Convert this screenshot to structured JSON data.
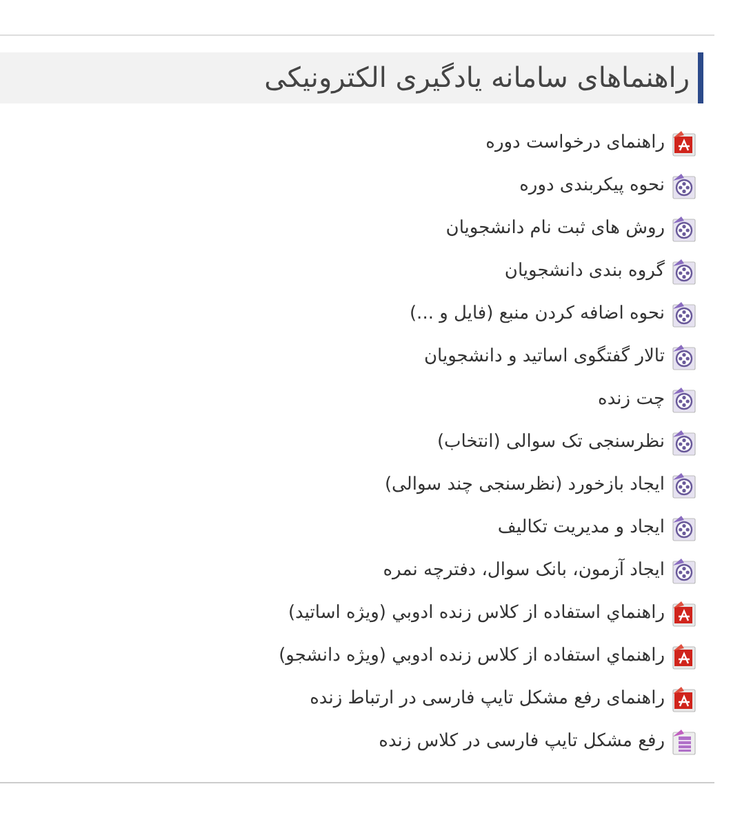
{
  "block": {
    "title": "راهنماهای سامانه یادگیری الکترونیکی"
  },
  "items": [
    {
      "kind": "pdf",
      "label": "راهنمای درخواست دوره"
    },
    {
      "kind": "video",
      "label": "نحوه پیکربندی دوره"
    },
    {
      "kind": "video",
      "label": "روش های ثبت نام دانشجویان"
    },
    {
      "kind": "video",
      "label": "گروه بندی دانشجویان"
    },
    {
      "kind": "video",
      "label": "نحوه اضافه کردن منبع (فایل و ...)"
    },
    {
      "kind": "video",
      "label": "تالار گفتگوی اساتید و دانشجویان"
    },
    {
      "kind": "video",
      "label": "چت زنده"
    },
    {
      "kind": "video",
      "label": "نظرسنجی تک سوالی (انتخاب)"
    },
    {
      "kind": "video",
      "label": "ایجاد بازخورد (نظرسنجی چند سوالی)"
    },
    {
      "kind": "video",
      "label": "ایجاد و مدیریت تکالیف"
    },
    {
      "kind": "video",
      "label": "ایجاد آزمون، بانک سوال، دفترچه نمره"
    },
    {
      "kind": "pdf",
      "label": "راهنماي استفاده از كلاس زنده ادوبي (ويژه اساتيد)"
    },
    {
      "kind": "pdf",
      "label": "راهنماي استفاده از كلاس زنده ادوبي (ويژه دانشجو)"
    },
    {
      "kind": "pdf",
      "label": "راهنمای رفع مشکل تایپ فارسی در ارتباط زنده"
    },
    {
      "kind": "doc",
      "label": "رفع مشکل تایپ فارسی در کلاس زنده"
    }
  ]
}
